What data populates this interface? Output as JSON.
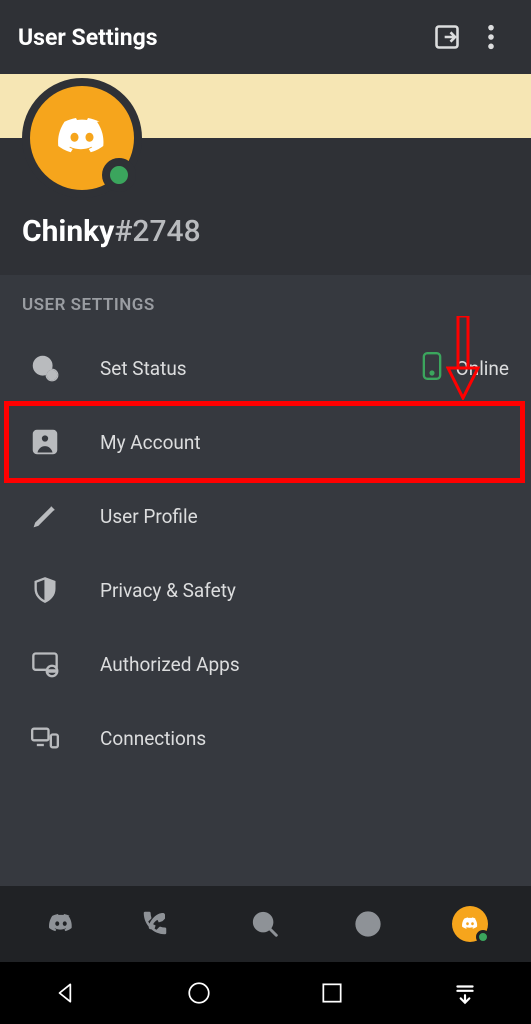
{
  "appbar": {
    "title": "User Settings"
  },
  "profile": {
    "name": "Chinky",
    "discriminator": "#2748"
  },
  "section_header": "USER SETTINGS",
  "rows": {
    "status": {
      "label": "Set Status",
      "value": "Online"
    },
    "account": {
      "label": "My Account"
    },
    "profile": {
      "label": "User Profile"
    },
    "privacy": {
      "label": "Privacy & Safety"
    },
    "apps": {
      "label": "Authorized Apps"
    },
    "connections": {
      "label": "Connections"
    }
  }
}
